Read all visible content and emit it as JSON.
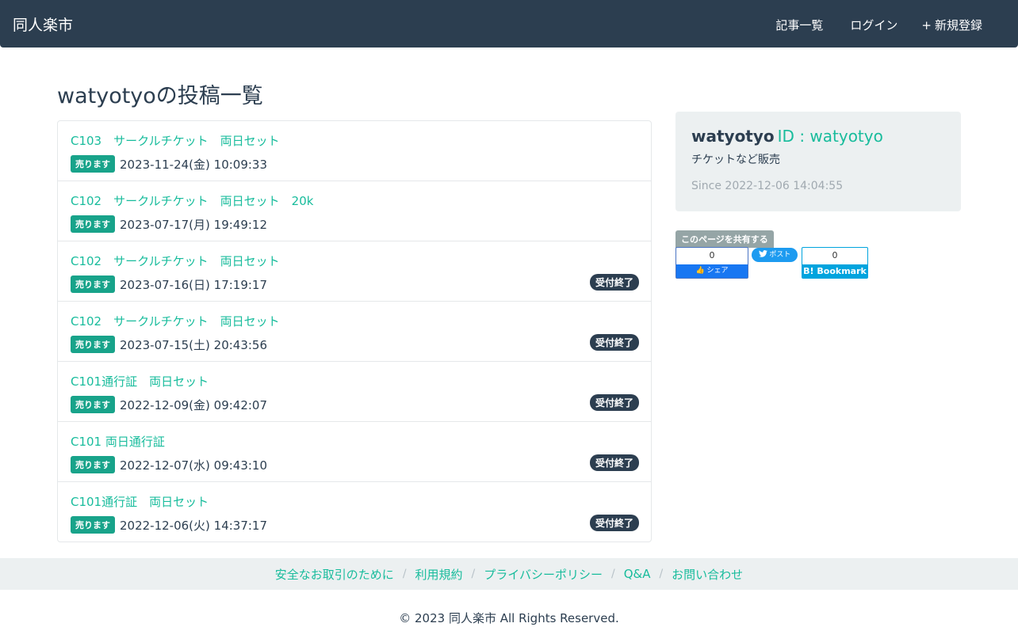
{
  "nav": {
    "brand": "同人楽市",
    "links": [
      {
        "icon": "",
        "label": "記事一覧"
      },
      {
        "icon": "",
        "label": "ログイン"
      },
      {
        "icon": "+",
        "label": "新規登録"
      }
    ]
  },
  "page": {
    "title": "watyotyoの投稿一覧"
  },
  "posts": [
    {
      "title": "C103　サークルチケット　両日セット",
      "badge": "売ります",
      "date": "2023-11-24(金) 10:09:33",
      "status": ""
    },
    {
      "title": "C102　サークルチケット　両日セット　20k",
      "badge": "売ります",
      "date": "2023-07-17(月) 19:49:12",
      "status": ""
    },
    {
      "title": "C102　サークルチケット　両日セット",
      "badge": "売ります",
      "date": "2023-07-16(日) 17:19:17",
      "status": "受付終了"
    },
    {
      "title": "C102　サークルチケット　両日セット",
      "badge": "売ります",
      "date": "2023-07-15(土) 20:43:56",
      "status": "受付終了"
    },
    {
      "title": "C101通行証　両日セット",
      "badge": "売ります",
      "date": "2022-12-09(金) 09:42:07",
      "status": "受付終了"
    },
    {
      "title": "C101 両日通行証",
      "badge": "売ります",
      "date": "2022-12-07(水) 09:43:10",
      "status": "受付終了"
    },
    {
      "title": "C101通行証　両日セット",
      "badge": "売ります",
      "date": "2022-12-06(火) 14:37:17",
      "status": "受付終了"
    }
  ],
  "profile": {
    "icon": "",
    "name": "watyotyo",
    "id_text": "ID : watyotyo",
    "description": "チケットなど販売",
    "since_icon": "",
    "since": "Since 2022-12-06 14:04:55"
  },
  "share": {
    "label": "このページを共有する",
    "fb_count": "0",
    "fb_button": "👍 シェア",
    "tw_button": "ポスト",
    "hb_count": "0",
    "hb_button": "B! Bookmark"
  },
  "footer": {
    "links": [
      "安全なお取引のために",
      "利用規約",
      "プライバシーポリシー",
      "Q&A",
      "お問い合わせ"
    ],
    "separator": "/",
    "copyright": "© 2023 同人楽市 All Rights Reserved."
  },
  "colors": {
    "navbar": "#2c3e50",
    "accent": "#18bc9c",
    "sell_badge": "#18a38a",
    "closed_badge": "#2c3e50"
  }
}
